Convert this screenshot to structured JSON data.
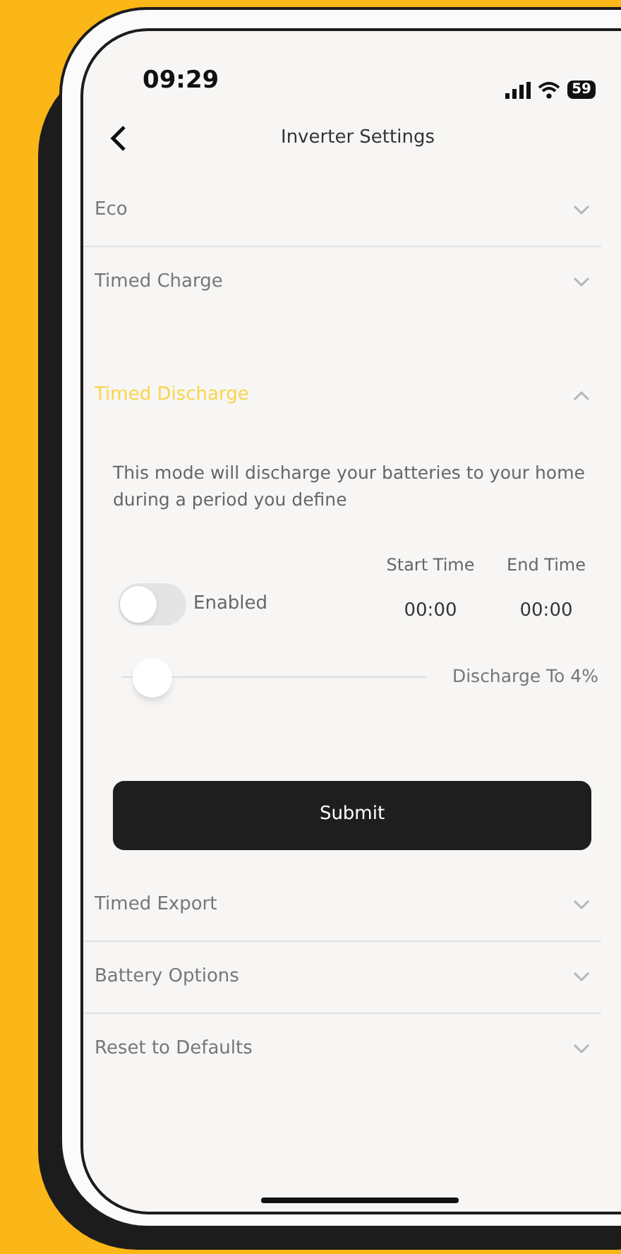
{
  "status_bar": {
    "time": "09:29",
    "battery": "59"
  },
  "header": {
    "title": "Inverter Settings"
  },
  "sections": [
    {
      "title": "Eco",
      "expanded": false
    },
    {
      "title": "Timed Charge",
      "expanded": false
    },
    {
      "title": "Timed Discharge",
      "expanded": true
    },
    {
      "title": "Timed Export",
      "expanded": false
    },
    {
      "title": "Battery Options",
      "expanded": false
    },
    {
      "title": "Reset to Defaults",
      "expanded": false
    }
  ],
  "panel": {
    "description": "This mode will discharge your batteries to your home during a period you define",
    "toggle": {
      "label": "Enabled",
      "on": false
    },
    "times": [
      {
        "label": "Start Time",
        "value": "00:00"
      },
      {
        "label": "End Time",
        "value": "00:00"
      }
    ],
    "slider": {
      "level": 0.04,
      "label": "Discharge To 4%"
    },
    "submit": "Submit"
  }
}
